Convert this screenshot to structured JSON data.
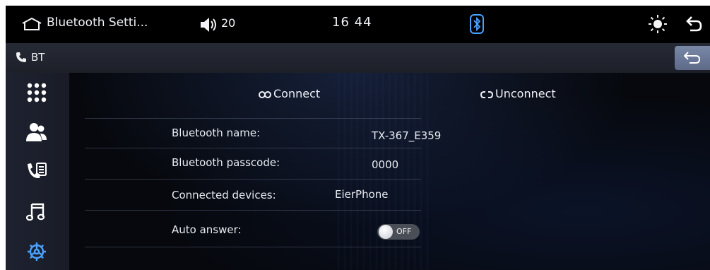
{
  "statusbar": {
    "title": "Bluetooth Setti...",
    "volume": "20",
    "clock": "16 44"
  },
  "subbar": {
    "label": "BT"
  },
  "sidebar": {
    "items": [
      {
        "icon": "keypad-icon"
      },
      {
        "icon": "contacts-icon"
      },
      {
        "icon": "call-log-icon"
      },
      {
        "icon": "music-note-icon"
      },
      {
        "icon": "settings-gear-icon",
        "active": true
      }
    ]
  },
  "actions": {
    "connect": "Connect",
    "unconnect": "Unconnect"
  },
  "settings": {
    "name_label": "Bluetooth name:",
    "name_value": "TX-367_E359",
    "passcode_label": "Bluetooth passcode:",
    "passcode_value": "0000",
    "devices_label": "Connected devices:",
    "devices_value": "EierPhone",
    "auto_answer_label": "Auto answer:",
    "auto_answer_state": "OFF"
  },
  "colors": {
    "accent": "#4aa3ff",
    "bar": "#000000",
    "subbar": "#22262f",
    "return_button": "#6b799a"
  }
}
